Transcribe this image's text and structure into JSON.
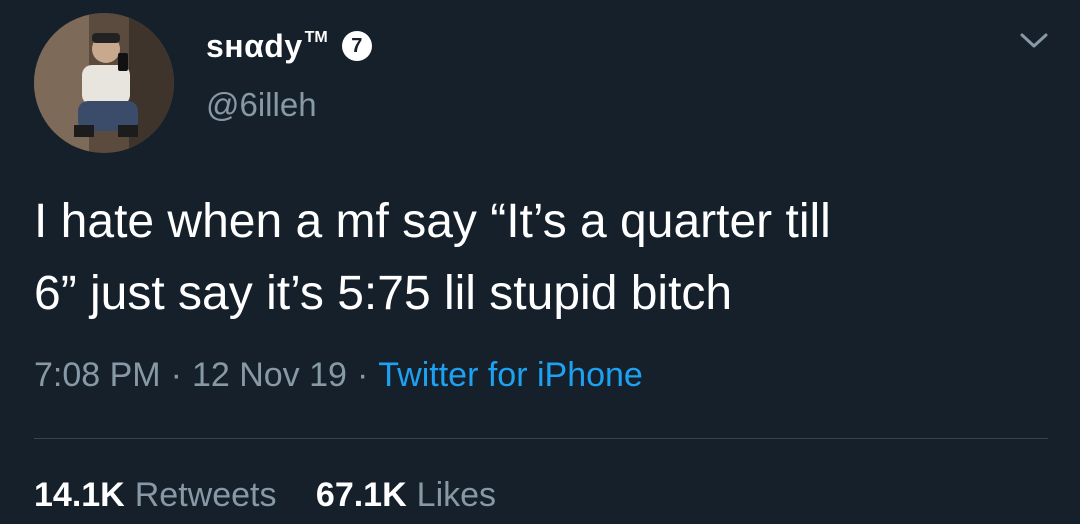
{
  "user": {
    "display_name": "sнαdу",
    "trademark": "TM",
    "badge": "7",
    "handle": "@6illeh"
  },
  "tweet": {
    "text_line1": "I hate when a mf say “It’s a quarter till",
    "text_line2": "6” just say it’s 5:75 lil stupid bitch",
    "time": "7:08 PM",
    "separator": "·",
    "date": "12 Nov 19",
    "source": "Twitter for iPhone"
  },
  "stats": {
    "retweets_count": "14.1K",
    "retweets_label": "Retweets",
    "likes_count": "67.1K",
    "likes_label": "Likes"
  },
  "icons": {
    "menu": "chevron-down-icon"
  },
  "colors": {
    "background": "#15202b",
    "secondary_text": "#8899a6",
    "link": "#1da1f2",
    "divider": "#38444d"
  }
}
